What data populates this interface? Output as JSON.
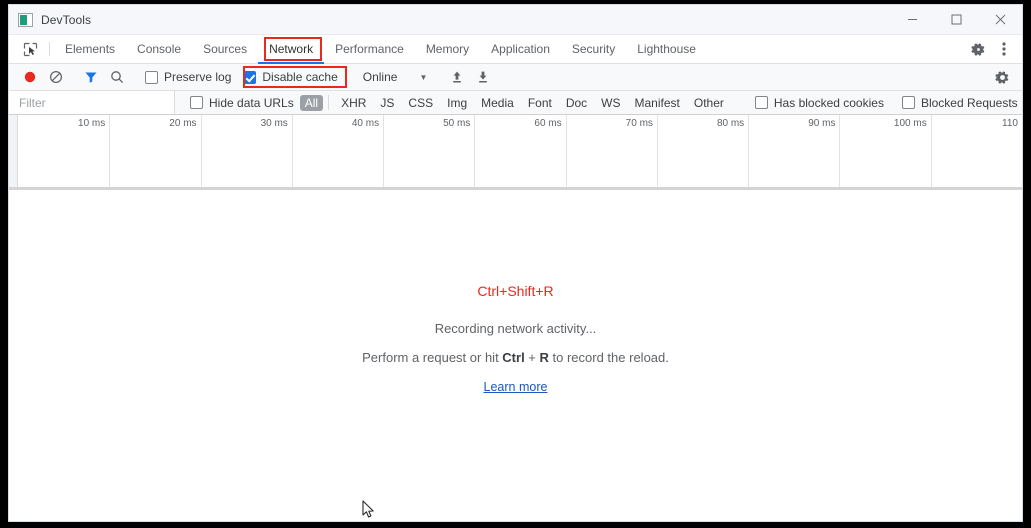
{
  "window": {
    "title": "DevTools",
    "app_icon": "devtools-icon",
    "minimize": "minimize-icon",
    "maximize": "maximize-icon",
    "close": "close-icon"
  },
  "tabbar": {
    "inspect_icon": "inspect-element-icon",
    "tabs": [
      {
        "label": "Elements",
        "active": false
      },
      {
        "label": "Console",
        "active": false
      },
      {
        "label": "Sources",
        "active": false
      },
      {
        "label": "Network",
        "active": true
      },
      {
        "label": "Performance",
        "active": false
      },
      {
        "label": "Memory",
        "active": false
      },
      {
        "label": "Application",
        "active": false
      },
      {
        "label": "Security",
        "active": false
      },
      {
        "label": "Lighthouse",
        "active": false
      }
    ],
    "settings_icon": "gear-icon",
    "more_icon": "three-dot-menu-icon",
    "annotation_color": "#e8291e"
  },
  "toolbar": {
    "record_icon": "record-button-icon",
    "clear_icon": "clear-icon",
    "filter_icon": "filter-funnel-icon",
    "search_icon": "search-icon",
    "preserve_log": {
      "label": "Preserve log",
      "checked": false
    },
    "disable_cache": {
      "label": "Disable cache",
      "checked": true
    },
    "throttle": {
      "value": "Online",
      "caret": "▼"
    },
    "import_icon": "import-har-icon",
    "export_icon": "export-har-icon",
    "settings_icon": "gear-icon"
  },
  "filterbar": {
    "filter_placeholder": "Filter",
    "filter_value": "",
    "hide_data_urls": {
      "label": "Hide data URLs",
      "checked": false
    },
    "types": [
      {
        "label": "All",
        "selected": true
      },
      {
        "label": "XHR",
        "selected": false
      },
      {
        "label": "JS",
        "selected": false
      },
      {
        "label": "CSS",
        "selected": false
      },
      {
        "label": "Img",
        "selected": false
      },
      {
        "label": "Media",
        "selected": false
      },
      {
        "label": "Font",
        "selected": false
      },
      {
        "label": "Doc",
        "selected": false
      },
      {
        "label": "WS",
        "selected": false
      },
      {
        "label": "Manifest",
        "selected": false
      },
      {
        "label": "Other",
        "selected": false
      }
    ],
    "has_blocked_cookies": {
      "label": "Has blocked cookies",
      "checked": false
    },
    "blocked_requests": {
      "label": "Blocked Requests",
      "checked": false
    }
  },
  "timeline": {
    "ticks": [
      "10 ms",
      "20 ms",
      "30 ms",
      "40 ms",
      "50 ms",
      "60 ms",
      "70 ms",
      "80 ms",
      "90 ms",
      "100 ms",
      "110"
    ]
  },
  "empty_state": {
    "shortcut": "Ctrl+Shift+R",
    "recording": "Recording network activity...",
    "perform_prefix": "Perform a request or hit ",
    "perform_key1": "Ctrl",
    "perform_plus": " + ",
    "perform_key2": "R",
    "perform_suffix": " to record the reload.",
    "learn_more": "Learn more"
  },
  "cursor": {
    "icon": "mouse-pointer-icon"
  }
}
